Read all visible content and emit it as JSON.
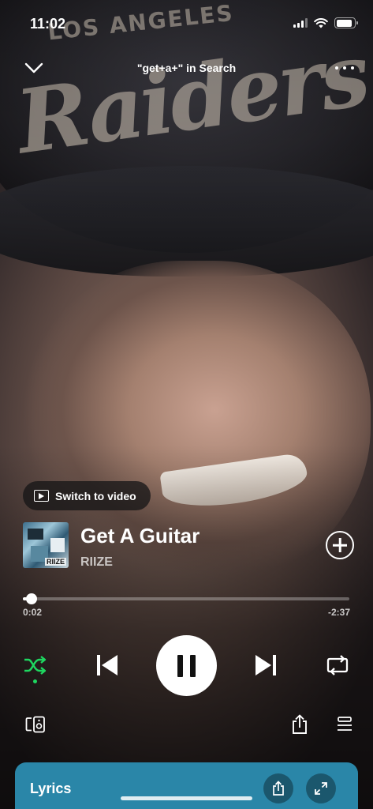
{
  "status_bar": {
    "time": "11:02"
  },
  "header": {
    "context": "\"get+a+\" in Search"
  },
  "switch_to_video": {
    "label": "Switch to video"
  },
  "track": {
    "title": "Get A Guitar",
    "artist": "RIIZE",
    "cover_text": "RIIZE"
  },
  "playback": {
    "elapsed": "0:02",
    "remaining": "-2:37",
    "progress_fraction": 0.013,
    "shuffle_on": true
  },
  "lyrics": {
    "label": "Lyrics"
  },
  "colors": {
    "accent": "#1ed760",
    "lyrics_card": "#2a86a8"
  },
  "icons": [
    "chevron-down-icon",
    "more-icon",
    "video-icon",
    "add-icon",
    "shuffle-icon",
    "previous-icon",
    "pause-icon",
    "next-icon",
    "repeat-icon",
    "devices-icon",
    "share-icon",
    "queue-icon",
    "expand-icon"
  ]
}
